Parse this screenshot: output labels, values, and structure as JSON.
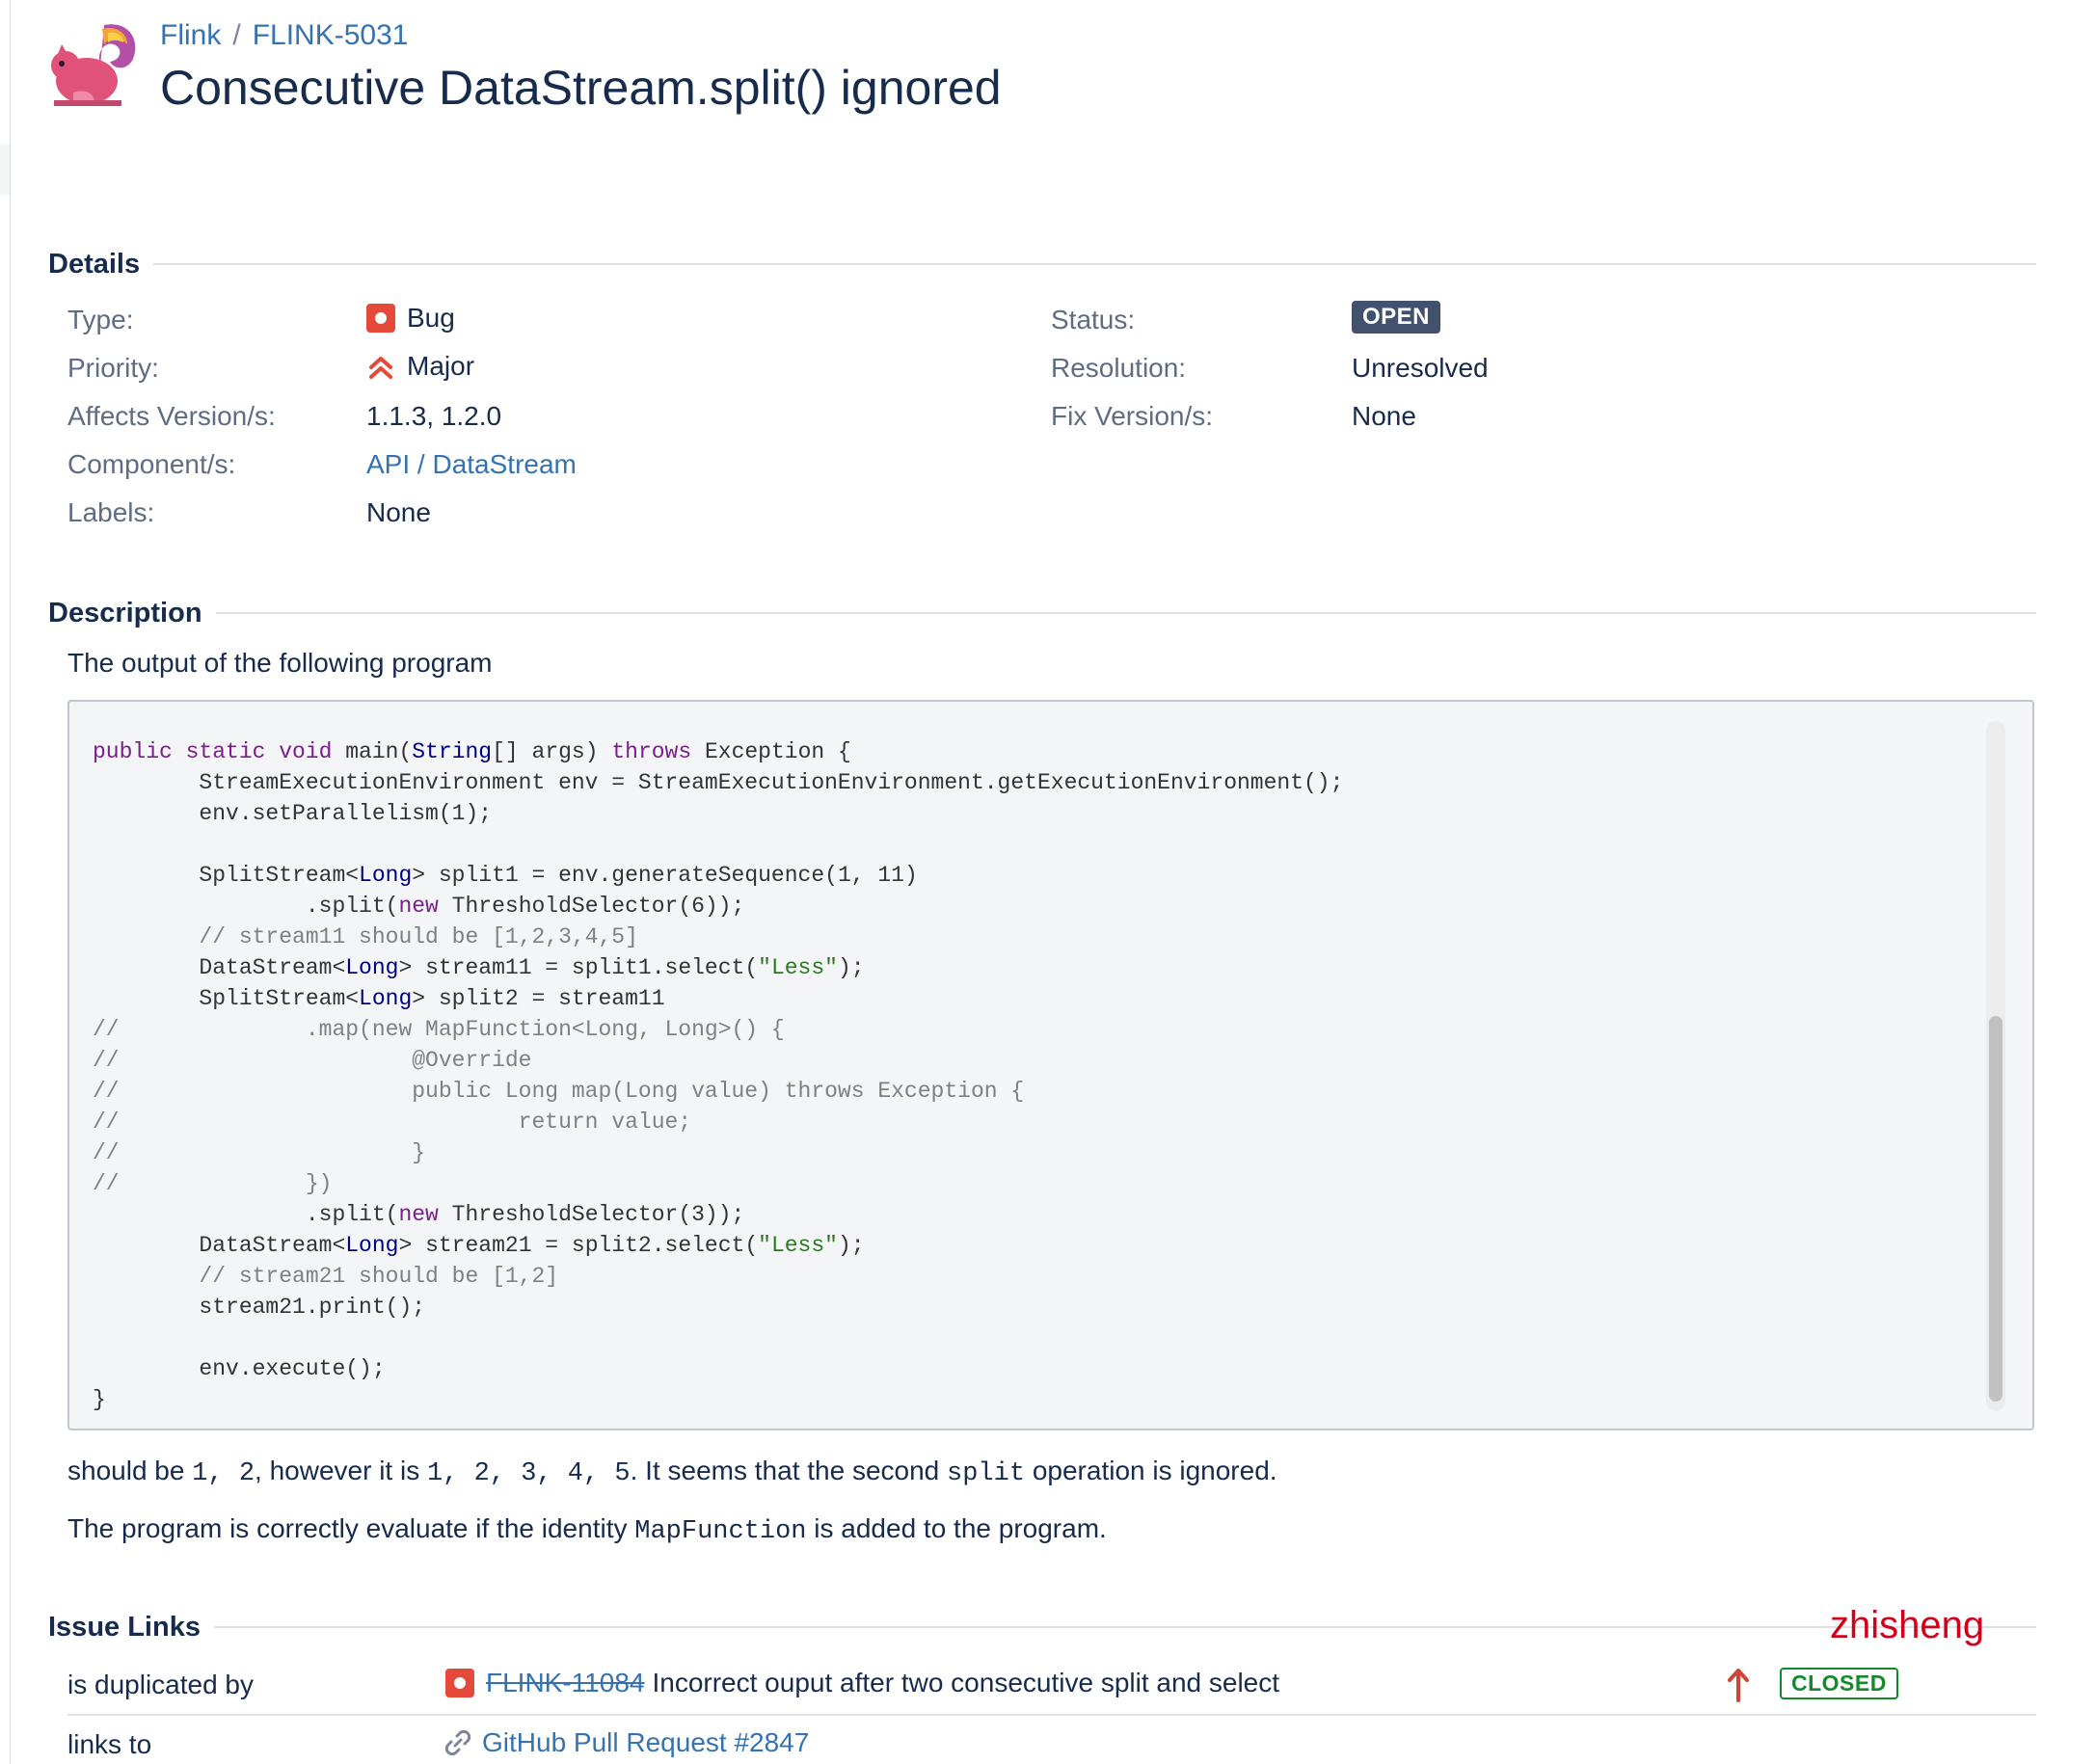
{
  "header": {
    "project": "Flink",
    "separator": "/",
    "issue_key": "FLINK-5031",
    "title": "Consecutive DataStream.split() ignored"
  },
  "details": {
    "heading": "Details",
    "left": [
      {
        "label": "Type:",
        "value": "Bug",
        "icon": "bug-icon"
      },
      {
        "label": "Priority:",
        "value": "Major",
        "icon": "priority-major-icon"
      },
      {
        "label": "Affects Version/s:",
        "value": "1.1.3, 1.2.0"
      },
      {
        "label": "Component/s:",
        "value": "API / DataStream"
      },
      {
        "label": "Labels:",
        "value": "None"
      }
    ],
    "right": [
      {
        "label": "Status:",
        "value": "OPEN"
      },
      {
        "label": "Resolution:",
        "value": "Unresolved"
      },
      {
        "label": "Fix Version/s:",
        "value": "None"
      }
    ]
  },
  "description": {
    "heading": "Description",
    "intro": "The output of the following program",
    "code_lines": [
      [
        {
          "t": "public static void",
          "c": "kw"
        },
        {
          "t": " main("
        },
        {
          "t": "String",
          "c": "ty"
        },
        {
          "t": "[] args) "
        },
        {
          "t": "throws",
          "c": "kw"
        },
        {
          "t": " Exception {"
        }
      ],
      [
        {
          "t": "        StreamExecutionEnvironment env = StreamExecutionEnvironment.getExecutionEnvironment();"
        }
      ],
      [
        {
          "t": "        env.setParallelism(1);"
        }
      ],
      [
        {
          "t": ""
        }
      ],
      [
        {
          "t": "        SplitStream<"
        },
        {
          "t": "Long",
          "c": "ty"
        },
        {
          "t": "> split1 = env.generateSequence(1, 11)"
        }
      ],
      [
        {
          "t": "                .split("
        },
        {
          "t": "new",
          "c": "kw"
        },
        {
          "t": " ThresholdSelector(6));"
        }
      ],
      [
        {
          "t": "        // stream11 should be [1,2,3,4,5]",
          "c": "cm"
        }
      ],
      [
        {
          "t": "        DataStream<"
        },
        {
          "t": "Long",
          "c": "ty"
        },
        {
          "t": "> stream11 = split1.select("
        },
        {
          "t": "\"Less\"",
          "c": "st"
        },
        {
          "t": ");"
        }
      ],
      [
        {
          "t": "        SplitStream<"
        },
        {
          "t": "Long",
          "c": "ty"
        },
        {
          "t": "> split2 = stream11"
        }
      ],
      [
        {
          "t": "//              .map(new MapFunction<Long, Long>() {",
          "c": "cm"
        }
      ],
      [
        {
          "t": "//                      @Override",
          "c": "cm"
        }
      ],
      [
        {
          "t": "//                      public Long map(Long value) throws Exception {",
          "c": "cm"
        }
      ],
      [
        {
          "t": "//                              return value;",
          "c": "cm"
        }
      ],
      [
        {
          "t": "//                      }",
          "c": "cm"
        }
      ],
      [
        {
          "t": "//              })",
          "c": "cm"
        }
      ],
      [
        {
          "t": "                .split("
        },
        {
          "t": "new",
          "c": "kw"
        },
        {
          "t": " ThresholdSelector(3));"
        }
      ],
      [
        {
          "t": "        DataStream<"
        },
        {
          "t": "Long",
          "c": "ty"
        },
        {
          "t": "> stream21 = split2.select("
        },
        {
          "t": "\"Less\"",
          "c": "st"
        },
        {
          "t": ");"
        }
      ],
      [
        {
          "t": "        // stream21 should be [1,2]",
          "c": "cm"
        }
      ],
      [
        {
          "t": "        stream21.print();"
        }
      ],
      [
        {
          "t": ""
        }
      ],
      [
        {
          "t": "        env.execute();"
        }
      ],
      [
        {
          "t": "}"
        }
      ]
    ],
    "after_1": {
      "a": "should be ",
      "b": "1, 2",
      "c": ", however it is ",
      "d": "1, 2, 3, 4, 5",
      "e": ". It seems that the second ",
      "f": "split",
      "g": " operation is ignored."
    },
    "after_2": {
      "a": "The program is correctly evaluate if the identity ",
      "b": "MapFunction",
      "c": " is added to the program."
    }
  },
  "issue_links": {
    "heading": "Issue Links",
    "username": "zhisheng",
    "rows": [
      {
        "relation": "is duplicated by",
        "key": "FLINK-11084",
        "summary": "Incorrect ouput after two consecutive split and select",
        "status": "CLOSED"
      },
      {
        "relation": "links to",
        "summary": "GitHub Pull Request #2847"
      }
    ]
  },
  "colors": {
    "link": "#3572b0",
    "bug": "#e5493a",
    "status_open": "#42526e",
    "status_closed": "#14892c",
    "username": "#d0021b"
  }
}
